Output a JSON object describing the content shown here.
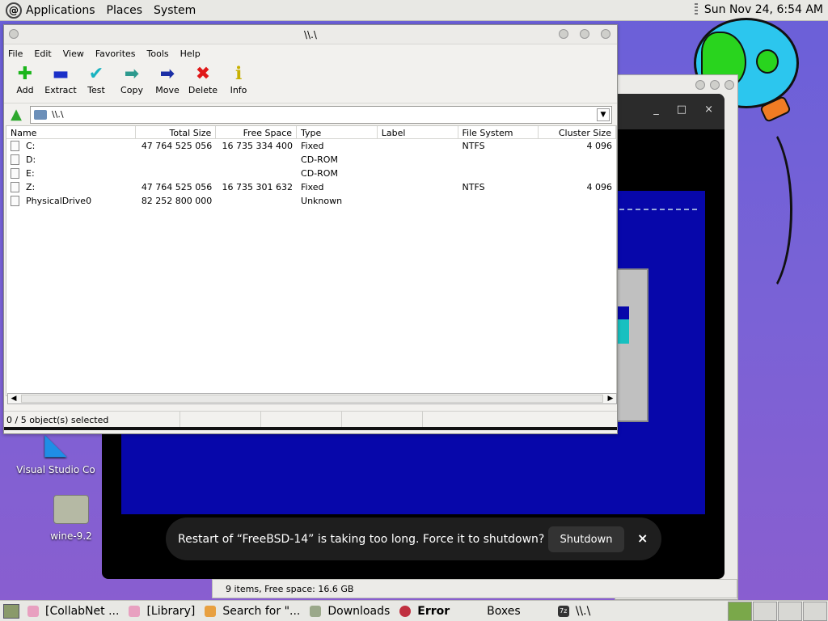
{
  "top_panel": {
    "logo": "debian-swirl-icon",
    "menus": [
      "Applications",
      "Places",
      "System"
    ],
    "clock": "Sun Nov 24,  6:54 AM"
  },
  "desktop": {
    "icons": [
      {
        "label": "Visual Studio Co",
        "icon": "vscode-icon"
      },
      {
        "label": "wine-9.2",
        "icon": "folder-icon"
      }
    ]
  },
  "boxes_window": {
    "controls": [
      "_",
      "□",
      "×"
    ]
  },
  "toast": {
    "message": "Restart of “FreeBSD-14” is taking too long. Force it to shutdown?",
    "button": "Shutdown",
    "close": "×"
  },
  "file_manager_status": "9 items, Free space: 16.6 GB",
  "zip_window": {
    "title": "\\\\.\\",
    "menus": [
      "File",
      "Edit",
      "View",
      "Favorites",
      "Tools",
      "Help"
    ],
    "toolbar": [
      {
        "label": "Add",
        "glyph": "✚",
        "color": "#1bb51b"
      },
      {
        "label": "Extract",
        "glyph": "▬",
        "color": "#1a2fc8"
      },
      {
        "label": "Test",
        "glyph": "✔",
        "color": "#19b3c0"
      },
      {
        "label": "Copy",
        "glyph": "➡",
        "color": "#2d9a8e"
      },
      {
        "label": "Move",
        "glyph": "➡",
        "color": "#1b2fa6"
      },
      {
        "label": "Delete",
        "glyph": "✖",
        "color": "#e01818"
      },
      {
        "label": "Info",
        "glyph": "ℹ",
        "color": "#c8b000"
      }
    ],
    "address": "\\\\.\\",
    "columns": [
      "Name",
      "Total Size",
      "Free Space",
      "Type",
      "Label",
      "File System",
      "Cluster Size"
    ],
    "rows": [
      [
        "C:",
        "47 764 525 056",
        "16 735 334 400",
        "Fixed",
        "",
        "NTFS",
        "4 096"
      ],
      [
        "D:",
        "",
        "",
        "CD-ROM",
        "",
        "",
        ""
      ],
      [
        "E:",
        "",
        "",
        "CD-ROM",
        "",
        "",
        ""
      ],
      [
        "Z:",
        "47 764 525 056",
        "16 735 301 632",
        "Fixed",
        "",
        "NTFS",
        "4 096"
      ],
      [
        "PhysicalDrive0",
        "82 252 800 000",
        "",
        "Unknown",
        "",
        "",
        ""
      ]
    ],
    "status": "0 / 5 object(s) selected"
  },
  "taskbar": {
    "tasks": [
      {
        "label": "[CollabNet ...",
        "color": "#e8a0c0",
        "bold": false
      },
      {
        "label": "[Library]",
        "color": "#e8a0c0",
        "bold": false
      },
      {
        "label": "Search for \"...",
        "color": "#e8a040",
        "bold": false
      },
      {
        "label": "Downloads",
        "color": "#9aa88a",
        "bold": false
      },
      {
        "label": "Error",
        "color": "#c03040",
        "bold": true
      },
      {
        "label": "Boxes",
        "color": "transparent",
        "bold": false
      },
      {
        "label": "\\\\.\\",
        "color": "#333333",
        "bold": false
      }
    ]
  }
}
